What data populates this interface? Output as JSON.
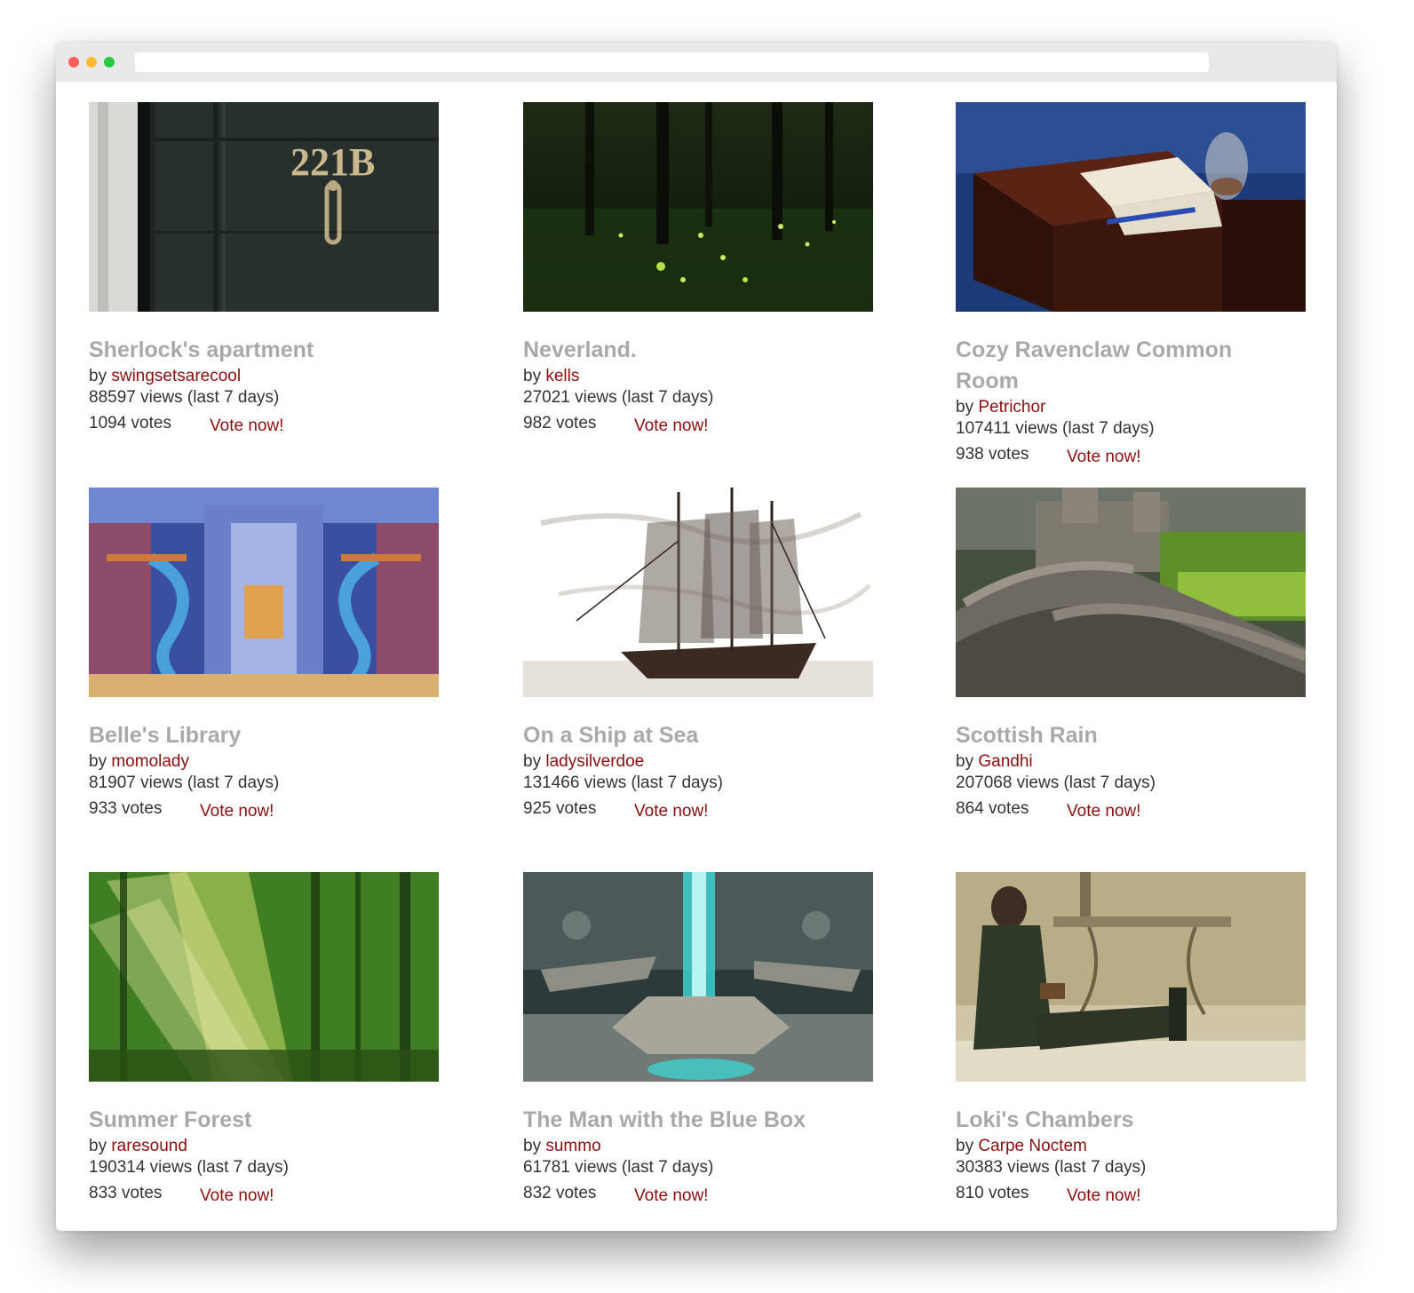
{
  "items": [
    {
      "title": "Sherlock's apartment",
      "by": "by",
      "author": "swingsetsarecool",
      "views": "88597 views (last 7 days)",
      "votes": "1094 votes",
      "vote_label": "Vote now!"
    },
    {
      "title": "Neverland.",
      "by": "by",
      "author": "kells",
      "views": "27021 views (last 7 days)",
      "votes": "982 votes",
      "vote_label": "Vote now!"
    },
    {
      "title": "Cozy Ravenclaw Common Room",
      "by": "by",
      "author": "Petrichor",
      "views": "107411 views (last 7 days)",
      "votes": "938 votes",
      "vote_label": "Vote now!"
    },
    {
      "title": "Belle's Library",
      "by": "by",
      "author": "momolady",
      "views": "81907 views (last 7 days)",
      "votes": "933 votes",
      "vote_label": "Vote now!"
    },
    {
      "title": "On a Ship at Sea",
      "by": "by",
      "author": "ladysilverdoe",
      "views": "131466 views (last 7 days)",
      "votes": "925 votes",
      "vote_label": "Vote now!"
    },
    {
      "title": "Scottish Rain",
      "by": "by",
      "author": "Gandhi",
      "views": "207068 views (last 7 days)",
      "votes": "864 votes",
      "vote_label": "Vote now!"
    },
    {
      "title": "Summer Forest",
      "by": "by",
      "author": "raresound",
      "views": "190314 views (last 7 days)",
      "votes": "833 votes",
      "vote_label": "Vote now!"
    },
    {
      "title": "The Man with the Blue Box",
      "by": "by",
      "author": "summo",
      "views": "61781 views (last 7 days)",
      "votes": "832 votes",
      "vote_label": "Vote now!"
    },
    {
      "title": "Loki's Chambers",
      "by": "by",
      "author": "Carpe Noctem",
      "views": "30383 views (last 7 days)",
      "votes": "810 votes",
      "vote_label": "Vote now!"
    }
  ],
  "door_number": "221B",
  "colors": {
    "title_gray": "#a9a9a9",
    "author_link": "#8b0e0e",
    "text": "#333333",
    "titlebar": "#e9e9e9"
  }
}
